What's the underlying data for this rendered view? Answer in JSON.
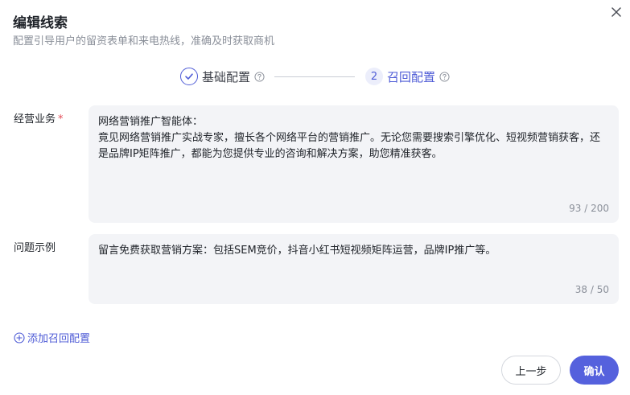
{
  "dialog": {
    "title": "编辑线索",
    "subtitle": "配置引导用户的留资表单和来电热线，准确及时获取商机"
  },
  "steps": [
    {
      "label": "基础配置",
      "status": "done"
    },
    {
      "number": "2",
      "label": "召回配置",
      "status": "active"
    }
  ],
  "fields": {
    "business": {
      "label": "经营业务",
      "required_mark": "*",
      "value": "网络营销推广智能体：\n竟见网络营销推广实战专家，擅长各个网络平台的营销推广。无论您需要搜索引擎优化、短视频营销获客，还是品牌IP矩阵推广，都能为您提供专业的咨询和解决方案，助您精准获客。",
      "counter": "93 / 200"
    },
    "example": {
      "label": "问题示例",
      "value": "留言免费获取营销方案：包括SEM竞价，抖音小红书短视频矩阵运营，品牌IP推广等。",
      "counter": "38 / 50"
    }
  },
  "add_recall": {
    "label": "添加召回配置"
  },
  "buttons": {
    "prev": "上一步",
    "confirm": "确认"
  },
  "colors": {
    "accent": "#4e5bd6",
    "primary_button": "#5561dd",
    "required": "#e34d59",
    "field_bg": "#f3f4f7"
  },
  "icons": {
    "close": "close-icon",
    "done": "check-icon",
    "help": "question-circle-icon",
    "add": "plus-circle-icon"
  }
}
